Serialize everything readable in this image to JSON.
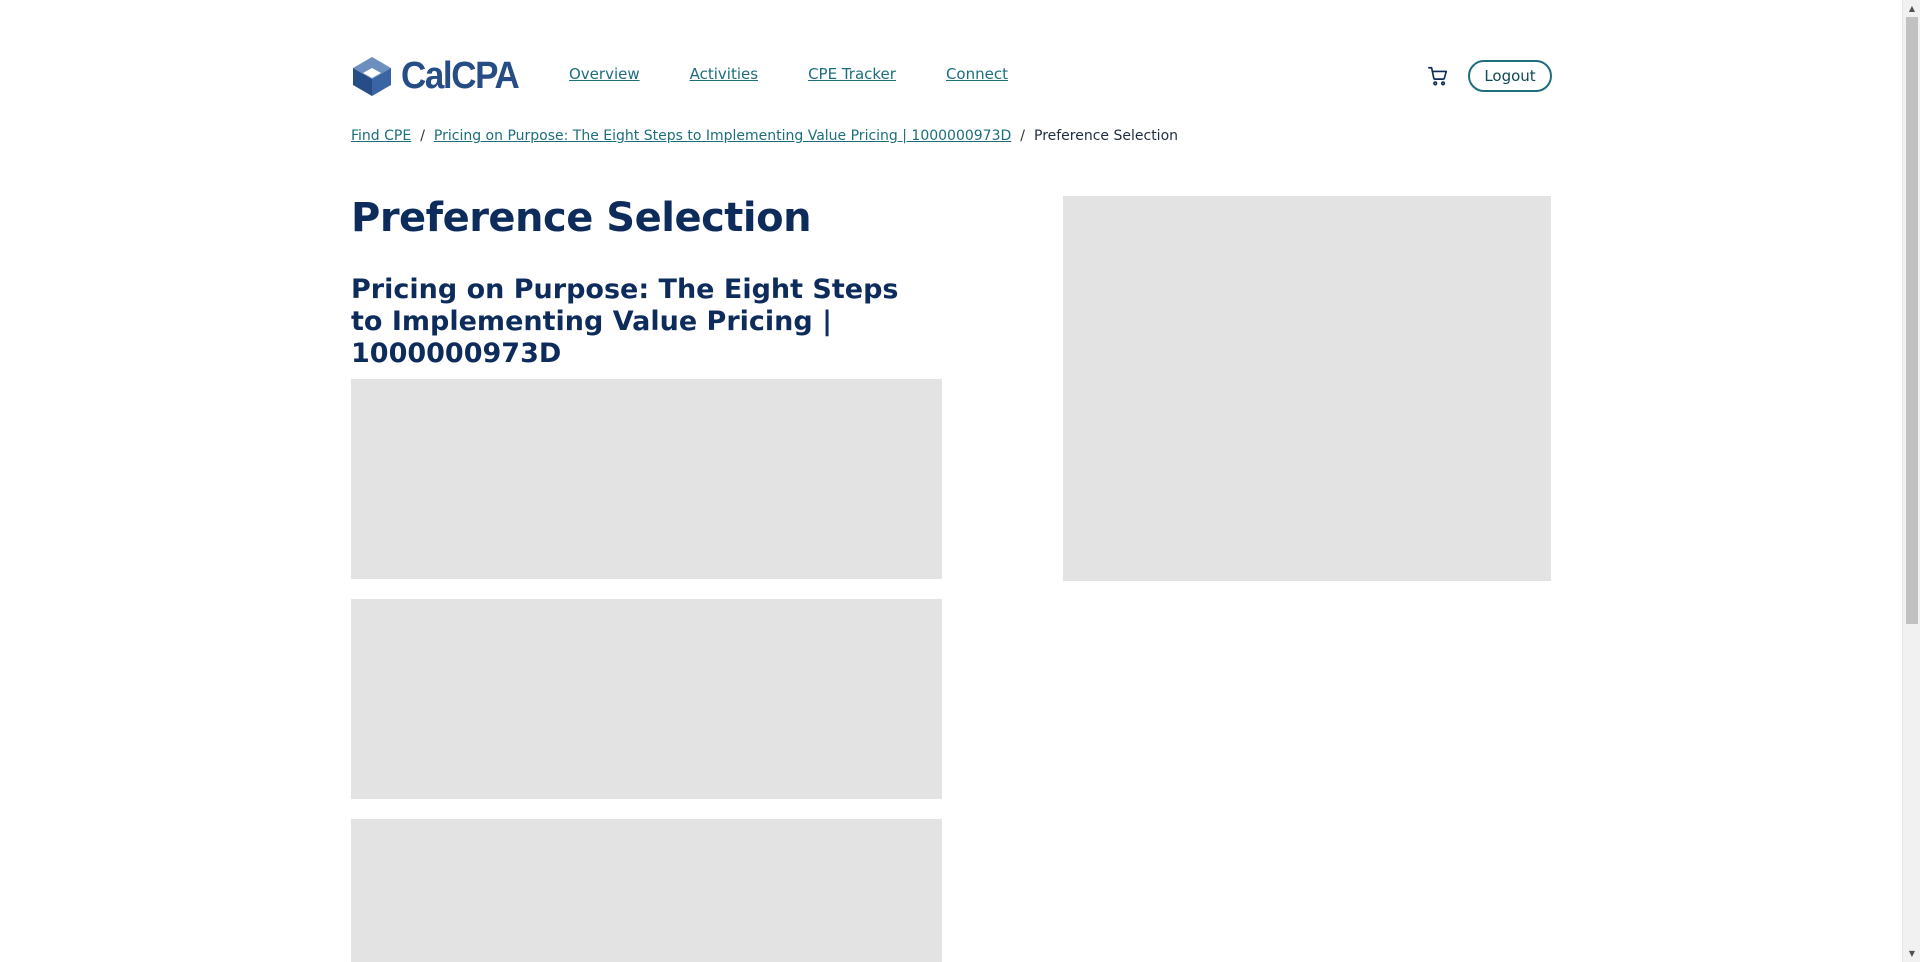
{
  "header": {
    "logo_text": "CalCPA",
    "nav": [
      {
        "label": "Overview"
      },
      {
        "label": "Activities"
      },
      {
        "label": "CPE Tracker"
      },
      {
        "label": "Connect"
      }
    ],
    "cart_icon": "cart-icon",
    "logout_label": "Logout"
  },
  "breadcrumb": {
    "items": [
      {
        "label": "Find CPE"
      },
      {
        "label": "Pricing on Purpose: The Eight Steps to Implementing Value Pricing | 1000000973D"
      }
    ],
    "separator": "/",
    "current": "Preference Selection"
  },
  "main": {
    "page_title": "Preference Selection",
    "course_title": "Pricing on Purpose: The Eight Steps to Implementing Value Pricing | 1000000973D"
  },
  "colors": {
    "brand_navy": "#0d2c5c",
    "link_teal": "#1c6e7d",
    "skeleton_gray": "#e3e3e3"
  }
}
